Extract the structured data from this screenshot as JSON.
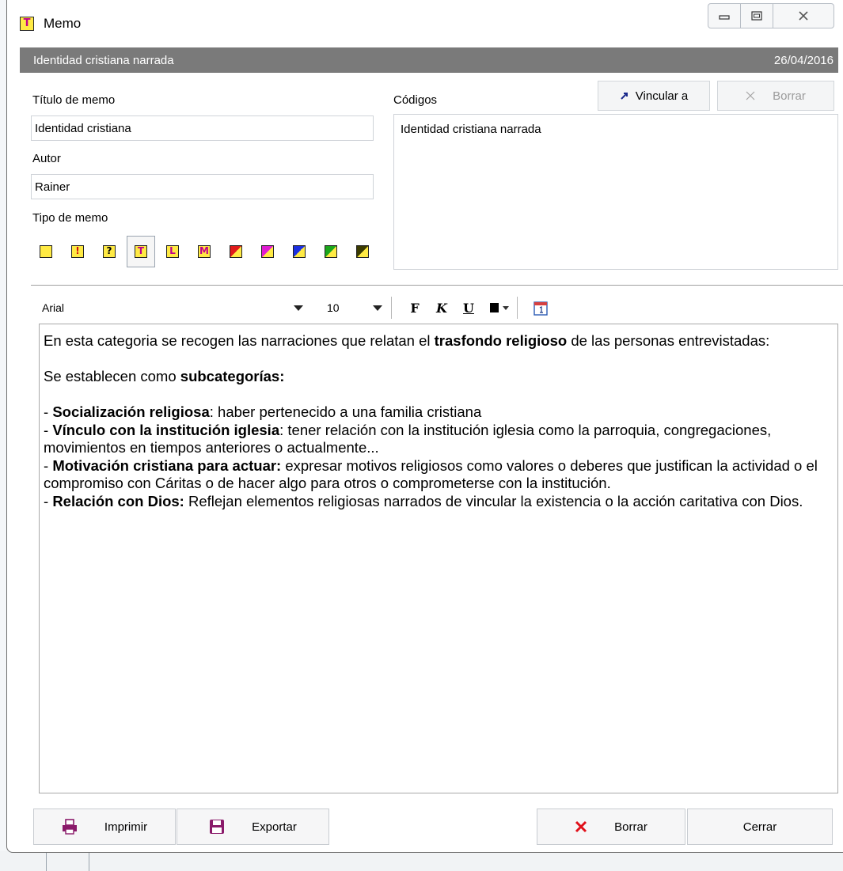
{
  "window": {
    "title": "Memo",
    "app_icon_letter": "T",
    "controls": {
      "minimize": "minimize",
      "maximize": "maximize",
      "close": "close"
    }
  },
  "header": {
    "left": "Identidad cristiana narrada",
    "right": "26/04/2016"
  },
  "memo_title": {
    "label": "Título de memo",
    "value": "Identidad cristiana"
  },
  "author": {
    "label": "Autor",
    "value": "Rainer"
  },
  "memo_type": {
    "label": "Tipo de memo",
    "options": [
      {
        "symbol": "",
        "icon": "memo-type-blank-icon"
      },
      {
        "symbol": "!",
        "icon": "memo-type-exclamation-icon"
      },
      {
        "symbol": "?",
        "icon": "memo-type-question-icon"
      },
      {
        "symbol": "T",
        "icon": "memo-type-t-icon",
        "selected": true
      },
      {
        "symbol": "L",
        "icon": "memo-type-l-icon"
      },
      {
        "symbol": "M",
        "icon": "memo-type-m-icon"
      },
      {
        "symbol": "",
        "icon": "memo-type-red-corner-icon",
        "corner": "#e01b1b"
      },
      {
        "symbol": "",
        "icon": "memo-type-magenta-corner-icon",
        "corner": "#e01bd2"
      },
      {
        "symbol": "",
        "icon": "memo-type-blue-corner-icon",
        "corner": "#1b2fe0"
      },
      {
        "symbol": "",
        "icon": "memo-type-green-corner-icon",
        "corner": "#1ba61b"
      },
      {
        "symbol": "",
        "icon": "memo-type-olive-corner-icon",
        "corner": "#3a3a00"
      }
    ]
  },
  "codes": {
    "label": "Códigos",
    "link_button": "Vincular a",
    "delete_button": "Borrar",
    "items": [
      "Identidad cristiana narrada"
    ]
  },
  "format_bar": {
    "font": "Arial",
    "size": "10",
    "bold": "F",
    "italic": "K",
    "underline": "U"
  },
  "memo_text": {
    "p1_a": "En esta categoria se recogen las narraciones que relatan el ",
    "p1_b": "trasfondo religioso",
    "p1_c": " de las personas entrevistadas:",
    "p2_a": "Se establecen como ",
    "p2_b": "subcategorías:",
    "i1_a": "- ",
    "i1_b": "Socialización religiosa",
    "i1_c": ": haber pertenecido a una familia cristiana",
    "i2_a": "- ",
    "i2_b": "Vínculo con la institución iglesia",
    "i2_c": ": tener relación con la institución iglesia como la parroquia, congregaciones, movimientos en tiempos anteriores o actualmente...",
    "i3_a": "- ",
    "i3_b": "Motivación cristiana para actuar:",
    "i3_c": " expresar motivos religiosos como valores o deberes que justifican la actividad o el compromiso con Cáritas o de hacer algo para otros o comprometerse con la institución.",
    "i4_a": "- ",
    "i4_b": "Relación con Dios:",
    "i4_c": " Reflejan elementos religiosas narrados de vincular la existencia o la acción caritativa con Dios."
  },
  "footer": {
    "print": "Imprimir",
    "export": "Exportar",
    "delete": "Borrar",
    "close": "Cerrar"
  },
  "colors": {
    "header_bg": "#7a7a7a",
    "memo_yellow": "#ffea44",
    "memo_magenta": "#c0008a",
    "delete_red": "#e0101a"
  }
}
